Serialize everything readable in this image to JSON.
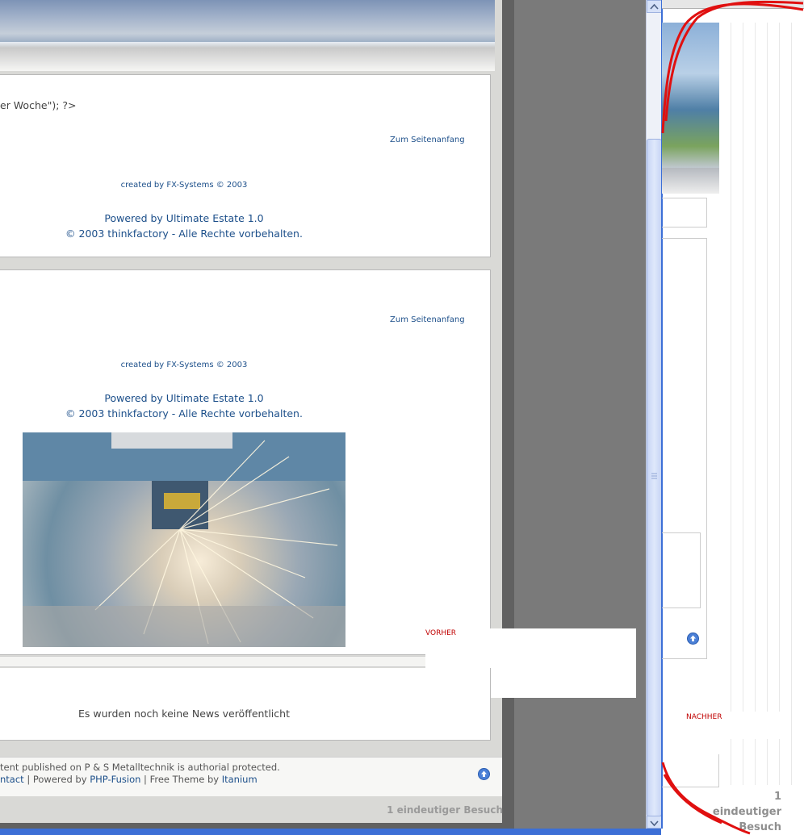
{
  "left_page": {
    "code_fragment": "er Woche\"); ?>",
    "panel1": {
      "top_link": "Zum Seitenanfang",
      "created_by": "created by FX-Systems © 2003",
      "powered_line1": "Powered by Ultimate Estate 1.0",
      "powered_line2": "© 2003 thinkfactory - Alle Rechte vorbehalten."
    },
    "panel2": {
      "top_link": "Zum Seitenanfang",
      "created_by": "created by FX-Systems © 2003",
      "powered_line1": "Powered by Ultimate Estate 1.0",
      "powered_line2": "© 2003 thinkfactory - Alle Rechte vorbehalten."
    },
    "overlay_label_before": "VORHER",
    "news_message": "Es wurden noch keine News veröffentlicht",
    "footer": {
      "copyright_text": "tent published on P & S Metalltechnik is authorial protected.",
      "contact_link": "ntact",
      "separator1": " | Powered by ",
      "php_fusion_link": "PHP-Fusion",
      "separator2": " | Free Theme by ",
      "theme_link": "Itanium"
    },
    "visits": "1 eindeutiger Besuch"
  },
  "right_page": {
    "overlay_label_after": "NACHHER",
    "visits_line1": "1",
    "visits_line2": "eindeutiger",
    "visits_line3": "Besuch"
  },
  "icons": {
    "scroll_top": "up-arrow-circle-icon",
    "scroll_up": "scroll-up-arrow-icon",
    "scroll_down": "scroll-down-arrow-icon"
  },
  "colors": {
    "link": "#1c4f8a",
    "annotation_red": "#e01010",
    "taskbar": "#3c6fd6"
  }
}
